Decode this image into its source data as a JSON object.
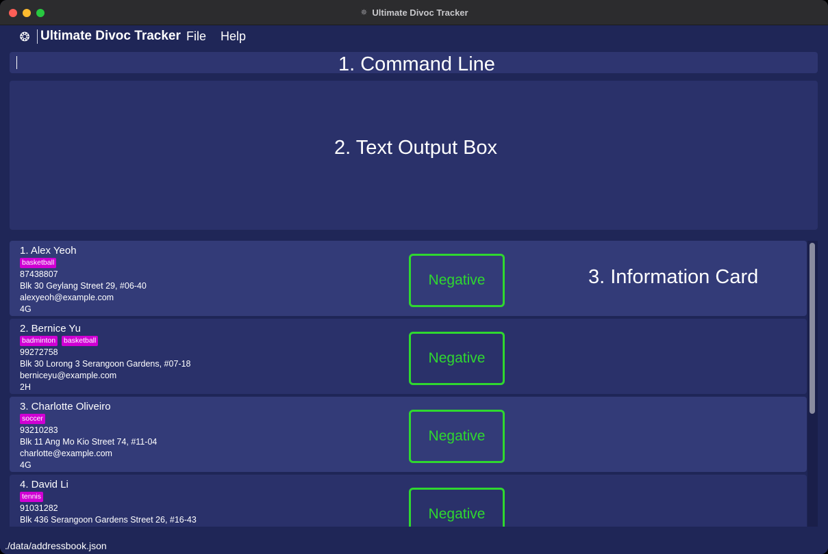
{
  "window": {
    "title": "Ultimate Divoc Tracker"
  },
  "menubar": {
    "app_name": "Ultimate Divoc Tracker",
    "file": "File",
    "help": "Help"
  },
  "command_box": {
    "label": "1. Command Line",
    "value": ""
  },
  "output_box": {
    "label": "2. Text Output Box"
  },
  "info_card_label": "3. Information Card",
  "persons": [
    {
      "name": "1.  Alex Yeoh",
      "tags": [
        "basketball"
      ],
      "phone": "87438807",
      "address": "Blk 30 Geylang Street 29, #06-40",
      "email": "alexyeoh@example.com",
      "room": "4G",
      "status": "Negative"
    },
    {
      "name": "2.  Bernice Yu",
      "tags": [
        "badminton",
        "basketball"
      ],
      "phone": "99272758",
      "address": "Blk 30 Lorong 3 Serangoon Gardens, #07-18",
      "email": "berniceyu@example.com",
      "room": "2H",
      "status": "Negative"
    },
    {
      "name": "3.  Charlotte Oliveiro",
      "tags": [
        "soccer"
      ],
      "phone": "93210283",
      "address": "Blk 11 Ang Mo Kio Street 74, #11-04",
      "email": "charlotte@example.com",
      "room": "4G",
      "status": "Negative"
    },
    {
      "name": "4.  David Li",
      "tags": [
        "tennis"
      ],
      "phone": "91031282",
      "address": "Blk 436 Serangoon Gardens Street 26, #16-43",
      "email": "",
      "room": "",
      "status": "Negative"
    }
  ],
  "status_bar": {
    "path": "./data/addressbook.json"
  },
  "colors": {
    "background": "#1f2657",
    "tag": "#d000d4",
    "status_negative": "#2fd82f"
  },
  "icons": {
    "app": "virus-icon"
  }
}
